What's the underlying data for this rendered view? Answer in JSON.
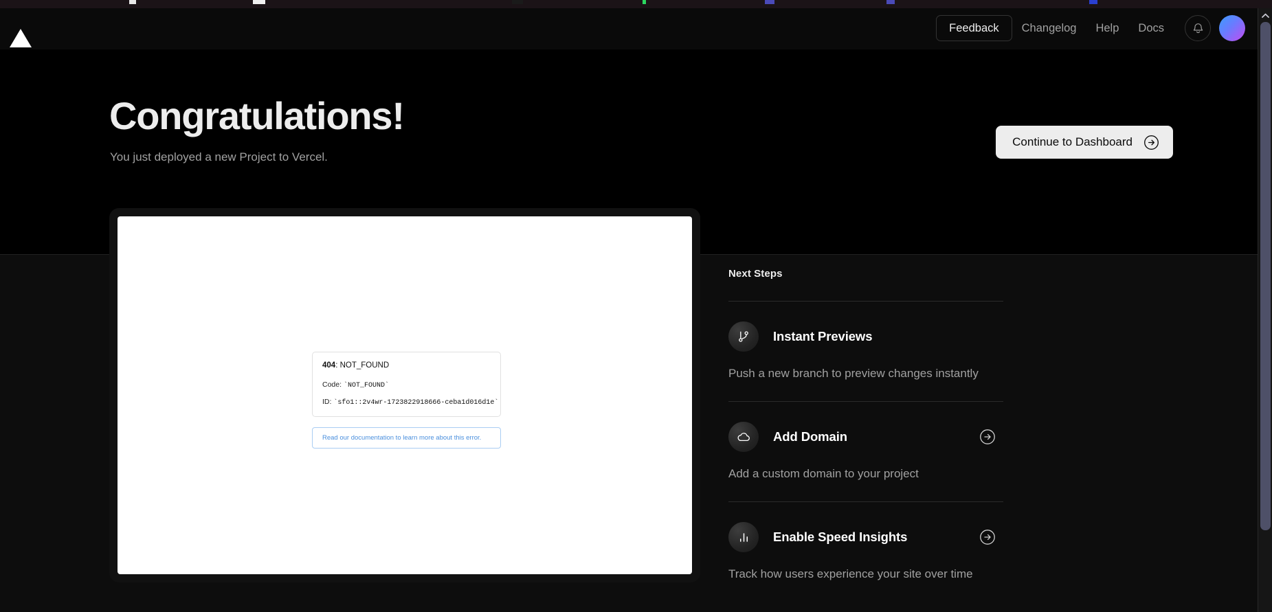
{
  "colors": {
    "page_bg": "#000000",
    "lower_bg": "#0d0d0d",
    "header_bg": "#0a0a0a",
    "text_primary": "#ededed",
    "text_muted": "#a1a1a1",
    "cta_bg": "#ededed",
    "link_blue": "#4a8fdd",
    "avatar_gradient_start": "#3b9dff",
    "avatar_gradient_end": "#c44bf0",
    "scrollbar_thumb": "#4e5068"
  },
  "header": {
    "logo": "vercel-triangle-logo",
    "feedback_label": "Feedback",
    "links": [
      {
        "label": "Changelog"
      },
      {
        "label": "Help"
      },
      {
        "label": "Docs"
      }
    ],
    "notifications_icon": "bell-icon",
    "avatar_alt": "user-avatar"
  },
  "hero": {
    "title": "Congratulations!",
    "subtitle": "You just deployed a new Project to Vercel.",
    "cta_label": "Continue to Dashboard",
    "cta_icon": "arrow-right-circle-icon"
  },
  "preview": {
    "error_code": "404",
    "error_separator": ": ",
    "error_name": "NOT_FOUND",
    "code_label": "Code: ",
    "code_value": "`NOT_FOUND`",
    "id_label": "ID: ",
    "id_value": "`sfo1::2v4wr-1723822918666-ceba1d016d1e`",
    "doc_link": "Read our documentation to learn more about this error."
  },
  "next_steps": {
    "heading": "Next Steps",
    "items": [
      {
        "title": "Instant Previews",
        "description": "Push a new branch to preview changes instantly",
        "icon": "git-branch-icon",
        "has_arrow": false
      },
      {
        "title": "Add Domain",
        "description": "Add a custom domain to your project",
        "icon": "cloud-icon",
        "has_arrow": true
      },
      {
        "title": "Enable Speed Insights",
        "description": "Track how users experience your site over time",
        "icon": "bar-chart-icon",
        "has_arrow": true
      }
    ]
  }
}
